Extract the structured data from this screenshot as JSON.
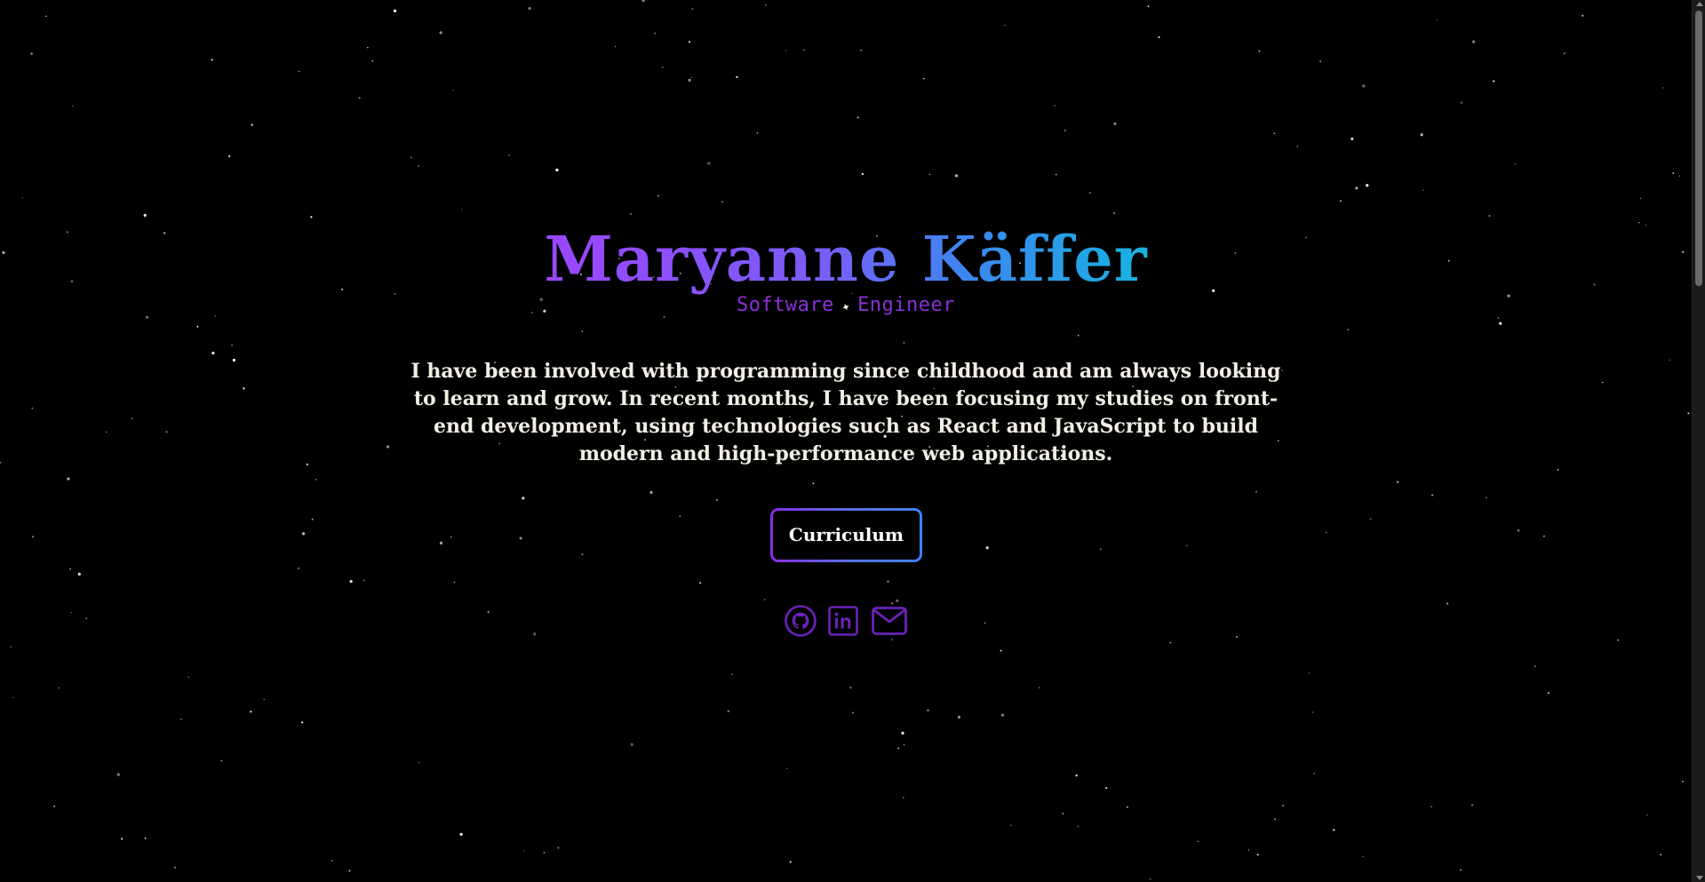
{
  "hero": {
    "name": "Maryanne Käffer",
    "subtitle_left": "Software",
    "subtitle_separator": "✦",
    "subtitle_right": "Engineer",
    "bio": "I have been involved with programming since childhood and am always looking to learn and grow. In recent months, I have been focusing my studies on front-end development, using technologies such as React and JavaScript to build modern and high-performance web applications.",
    "cv_button_label": "Curriculum"
  },
  "socials": [
    {
      "icon": "github-icon",
      "label": "GitHub"
    },
    {
      "icon": "linkedin-icon",
      "label": "LinkedIn"
    },
    {
      "icon": "mail-icon",
      "label": "Email"
    }
  ],
  "colors": {
    "background": "#000000",
    "name_gradient_start": "#9b46ff",
    "name_gradient_end": "#17b2e0",
    "subtitle": "#8b2fd8",
    "bio_text": "#f1eee6",
    "icon": "#6a22b8",
    "button_border_start": "#8a2be2",
    "button_border_end": "#3b82f6"
  }
}
